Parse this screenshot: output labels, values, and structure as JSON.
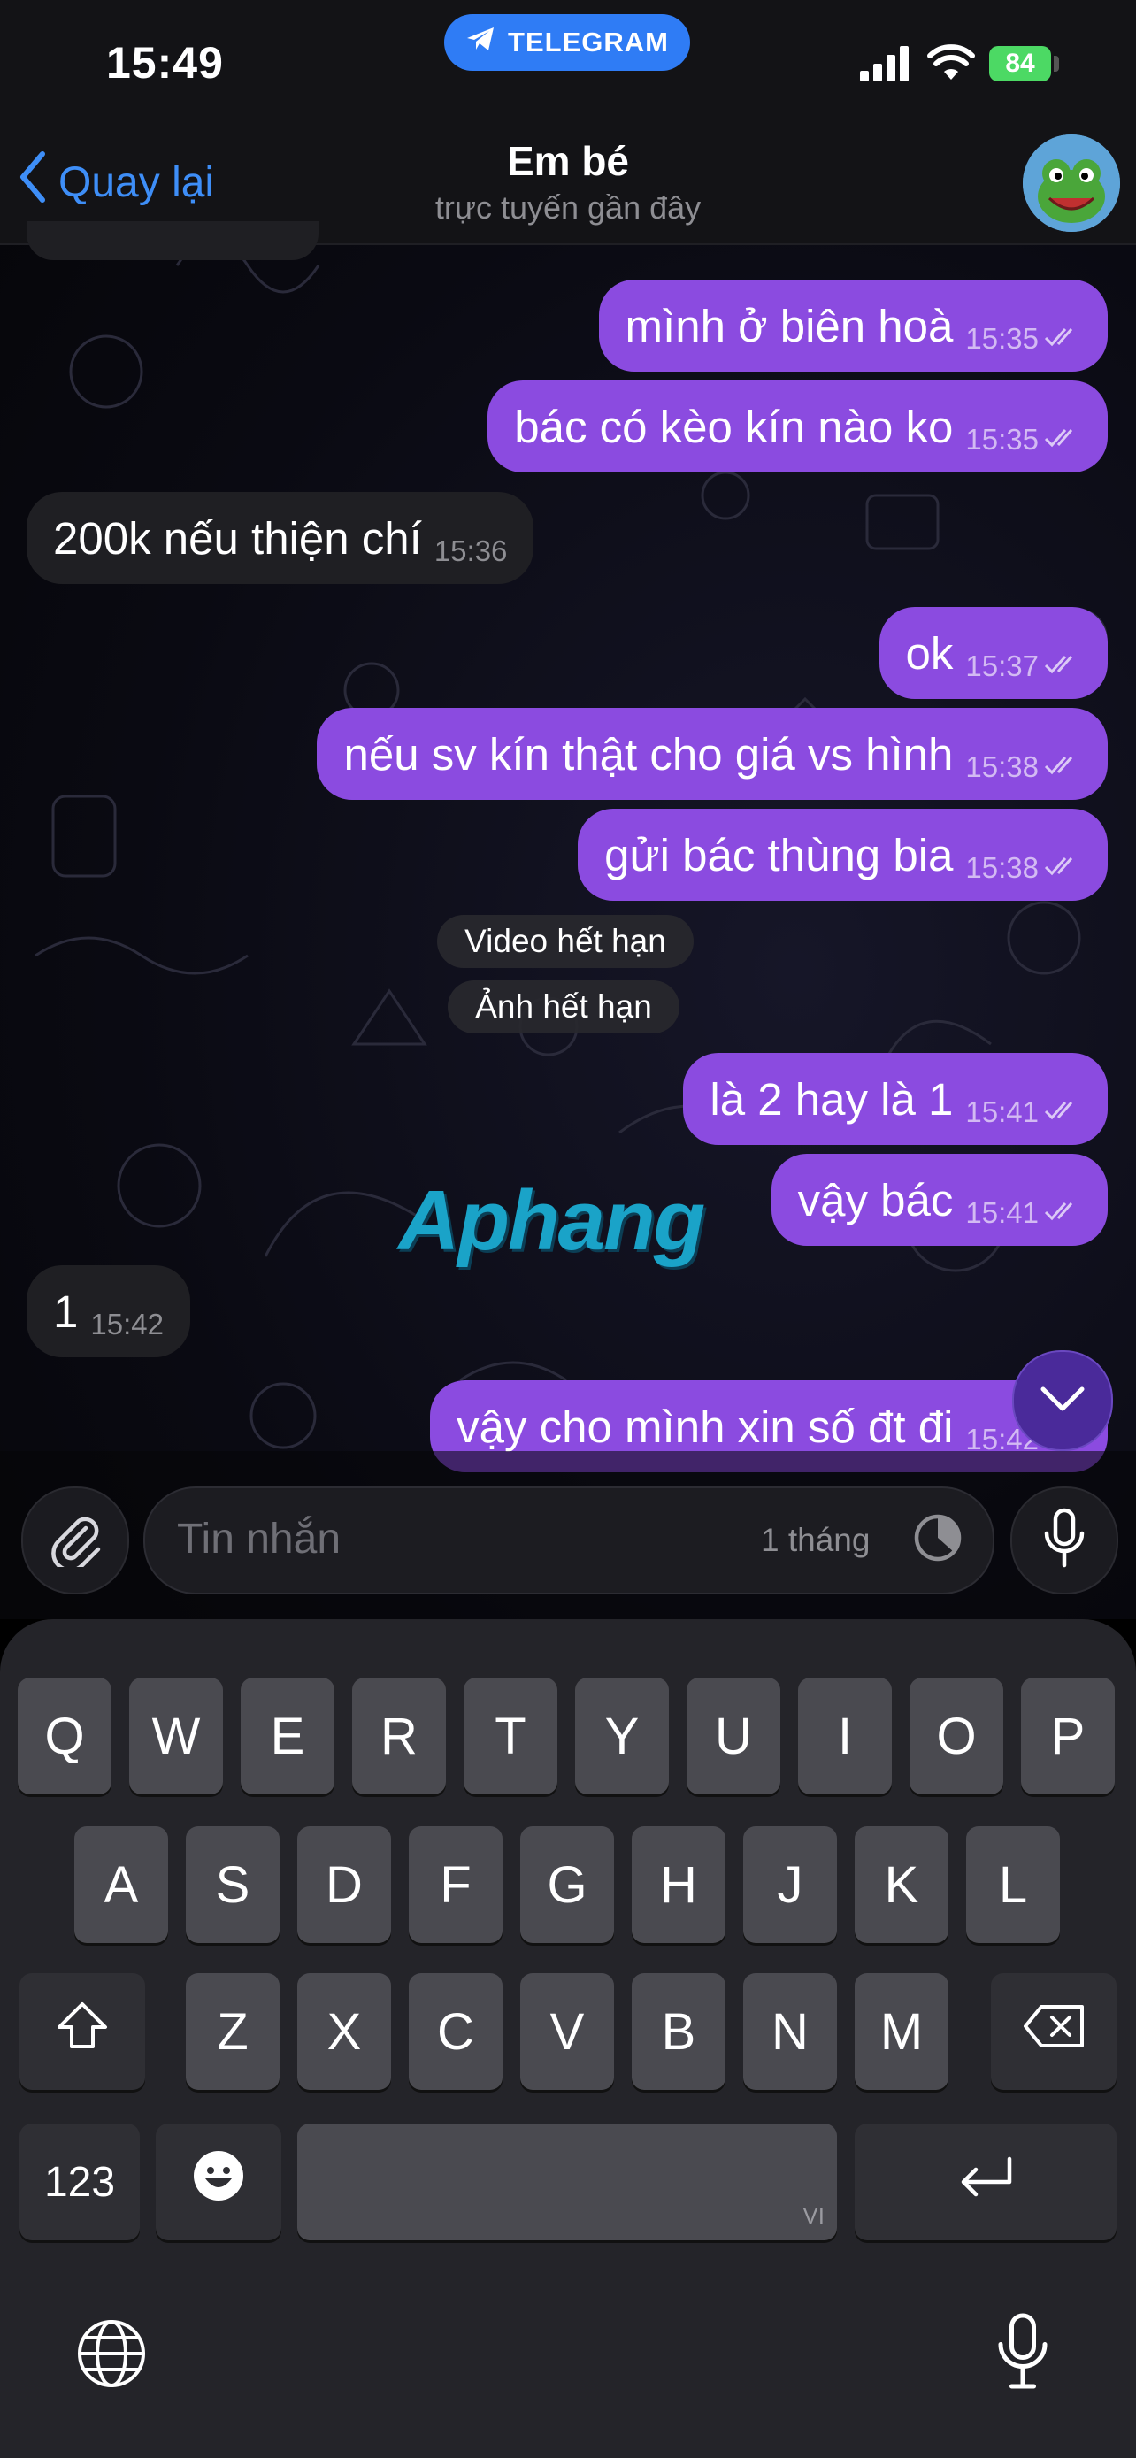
{
  "status_bar": {
    "time": "15:49",
    "app_pill": "TELEGRAM",
    "battery": "84"
  },
  "header": {
    "back_label": "Quay lại",
    "title": "Em bé",
    "subtitle": "trực tuyến gần đây"
  },
  "messages": [
    {
      "text": "mình ở biên hoà",
      "time": "15:35"
    },
    {
      "text": "bác có kèo kín nào ko",
      "time": "15:35"
    },
    {
      "text": "200k nếu thiện chí",
      "time": "15:36"
    },
    {
      "text": "ok",
      "time": "15:37"
    },
    {
      "text": "nếu sv kín thật cho giá vs hình",
      "time": "15:38"
    },
    {
      "text": "gửi bác thùng bia",
      "time": "15:38"
    },
    {
      "text": "là 2 hay là 1",
      "time": "15:41"
    },
    {
      "text": "vậy bác",
      "time": "15:41"
    },
    {
      "text": "1",
      "time": "15:42"
    },
    {
      "text": "vậy cho mình xin số đt đi",
      "time": "15:42"
    }
  ],
  "service_messages": [
    "Video hết hạn",
    "Ảnh hết hạn"
  ],
  "watermark": "Aphang",
  "composer": {
    "placeholder": "Tin nhắn",
    "timer": "1 tháng"
  },
  "keyboard": {
    "row1": [
      "Q",
      "W",
      "E",
      "R",
      "T",
      "Y",
      "U",
      "I",
      "O",
      "P"
    ],
    "row2": [
      "A",
      "S",
      "D",
      "F",
      "G",
      "H",
      "J",
      "K",
      "L"
    ],
    "row3": [
      "Z",
      "X",
      "C",
      "V",
      "B",
      "N",
      "M"
    ],
    "numbers_key": "123",
    "space_hint": "VI"
  },
  "colors": {
    "accent": "#3e8ef7",
    "outgoing_bubble": "#8b4be0",
    "incoming_bubble": "#1f1f23",
    "telegram_pill": "#2f7cf5",
    "battery": "#4cd964"
  }
}
